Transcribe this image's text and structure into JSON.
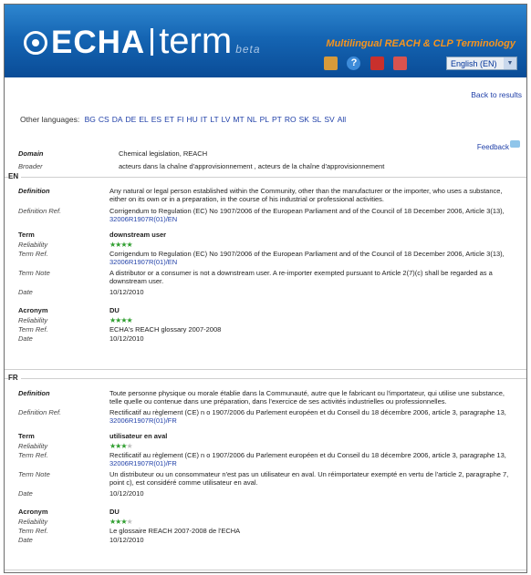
{
  "header": {
    "logo_echa": "ECHA",
    "logo_term": "term",
    "logo_beta": "beta",
    "tagline": "Multilingual REACH & CLP Terminology",
    "language_select": "English (EN)",
    "icons": [
      "home-icon",
      "help-icon",
      "book-icon",
      "exit-icon"
    ]
  },
  "nav": {
    "back_to_results": "Back to results",
    "other_languages_label": "Other languages:",
    "other_languages": [
      "BG",
      "CS",
      "DA",
      "DE",
      "EL",
      "ES",
      "ET",
      "FI",
      "HU",
      "IT",
      "LT",
      "LV",
      "MT",
      "NL",
      "PL",
      "PT",
      "RO",
      "SK",
      "SL",
      "SV",
      "All"
    ],
    "feedback": "Feedback"
  },
  "meta": {
    "domain_label": "Domain",
    "domain_value": "Chemical legislation, REACH",
    "broader_label": "Broader",
    "broader_value": "acteurs dans la chaîne d'approvisionnement , acteurs de la chaîne d'approvisionnement"
  },
  "en": {
    "section": "EN",
    "definition_label": "Definition",
    "definition": "Any natural or legal person established within the Community, other than the manufacturer or the importer, who uses a substance, either on its own or in a preparation, in the course of his industrial or professional activities.",
    "definition_ref_label": "Definition Ref.",
    "definition_ref": "Corrigendum to Regulation (EC) No 1907/2006 of the European Parliament and of the Council of 18 December 2006, Article 3(13),",
    "definition_ref_link": "32006R1907R(01)/EN",
    "term_label": "Term",
    "term": "downstream user",
    "reliability_label": "Reliability",
    "term_reliability": 4,
    "term_ref_label": "Term Ref.",
    "term_ref": "Corrigendum to Regulation (EC) No 1907/2006 of the European Parliament and of the Council of 18 December 2006, Article 3(13),",
    "term_ref_link": "32006R1907R(01)/EN",
    "term_note_label": "Term Note",
    "term_note": "A distributor or a consumer is not a downstream user. A re-importer exempted pursuant to Article 2(7)(c) shall be regarded as a downstream user.",
    "date_label": "Date",
    "term_date": "10/12/2010",
    "acronym_label": "Acronym",
    "acronym": "DU",
    "acronym_reliability": 4,
    "acronym_ref": "ECHA's REACH glossary 2007-2008",
    "acronym_date": "10/12/2010"
  },
  "fr": {
    "section": "FR",
    "definition_label": "Definition",
    "definition": "Toute personne physique ou morale établie dans la Communauté, autre que le fabricant ou l'importateur, qui utilise une substance, telle quelle ou contenue dans une préparation, dans l'exercice de ses activités industrielles ou professionnelles.",
    "definition_ref_label": "Definition Ref.",
    "definition_ref": "Rectificatif au règlement (CE) n o 1907/2006 du Parlement européen et du Conseil du 18 décembre 2006, article 3, paragraphe 13,",
    "definition_ref_link": "32006R1907R(01)/FR",
    "term_label": "Term",
    "term": "utilisateur en aval",
    "reliability_label": "Reliability",
    "term_reliability": 3,
    "term_ref_label": "Term Ref.",
    "term_ref": "Rectificatif au règlement (CE) n o 1907/2006 du Parlement européen et du Conseil du 18 décembre 2006, article 3, paragraphe 13,",
    "term_ref_link": "32006R1907R(01)/FR",
    "term_note_label": "Term Note",
    "term_note": "Un distributeur ou un consommateur n'est pas un utilisateur en aval. Un réimportateur exempté en vertu de l'article 2, paragraphe 7, point c), est considéré comme utilisateur en aval.",
    "date_label": "Date",
    "term_date": "10/12/2010",
    "acronym_label": "Acronym",
    "acronym": "DU",
    "acronym_reliability": 3,
    "acronym_ref": "Le glossaire REACH 2007-2008 de l'ECHA",
    "acronym_date": "10/12/2010"
  }
}
